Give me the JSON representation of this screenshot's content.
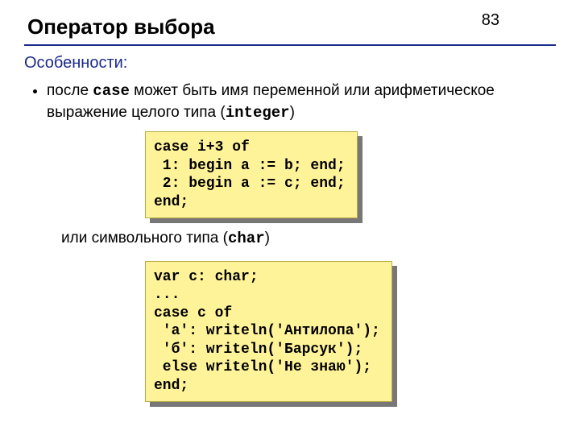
{
  "page_number": "83",
  "title": "Оператор выбора",
  "subheading": "Особенности:",
  "bullet1_pre": "после ",
  "bullet1_kw": "case",
  "bullet1_mid": " может быть имя переменной или арифметическое выражение целого типа (",
  "bullet1_type": "integer",
  "bullet1_post": ")",
  "line2_pre": "или символьного типа (",
  "line2_type": "char",
  "line2_post": ")",
  "code1": "case i+3 of\n 1: begin a := b; end;\n 2: begin a := c; end;\nend;",
  "code2": "var c: char;\n...\ncase c of\n 'а': writeln('Антилопа');\n 'б': writeln('Барсук');\n else writeln('Не знаю');\nend;"
}
